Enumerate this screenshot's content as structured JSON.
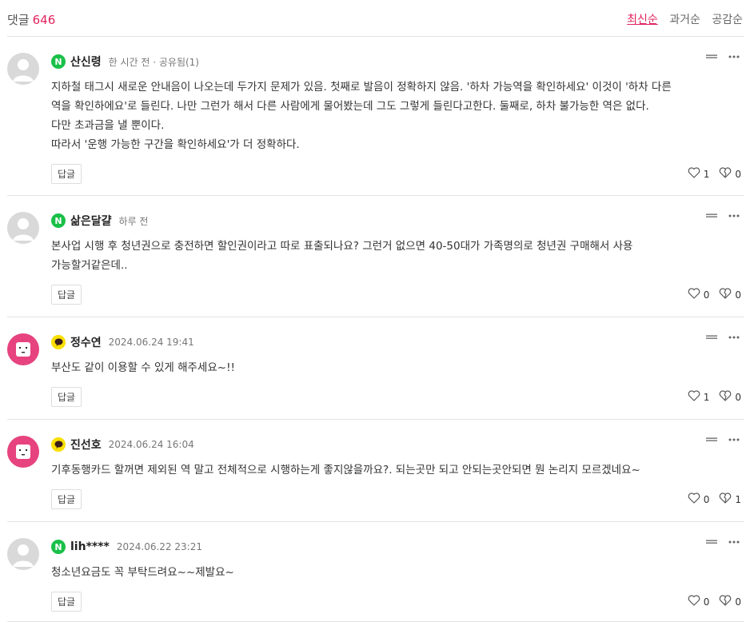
{
  "header": {
    "count_label": "댓글",
    "count_value": "646",
    "sort_options": [
      "최신순",
      "과거순",
      "공감순"
    ],
    "active_sort": "최신순"
  },
  "comments": [
    {
      "name": "산신령",
      "badge": "N",
      "time": "한 시간 전 · 공유됨(1)",
      "text": "지하철 태그시 새로운 안내음이 나오는데 두가지 문제가 있음. 첫째로 발음이 정확하지 않음. '하차 가능역을 확인하세요' 이것이 '하차 다른\n역을 확인하에요'로 들린다. 나만 그런가 해서 다른 사람에게 물어봤는데 그도 그렇게 들린다고한다. 둘째로, 하차 불가능한 역은 없다.\n다만 초과금을 낼 뿐이다.\n따라서 '운행 가능한 구간을 확인하세요'가 더 정확하다.",
      "reply_label": "답글",
      "likes": "1",
      "dislikes": "0",
      "avatar": "default"
    },
    {
      "name": "삶은달걀",
      "badge": "N",
      "time": "하루 전",
      "text": "본사업 시행 후 청년권으로 충전하면 할인권이라고 따로 표출되나요? 그런거 없으면 40-50대가 가족명의로 청년권 구매해서 사용\n가능할거같은데..",
      "reply_label": "답글",
      "likes": "0",
      "dislikes": "0",
      "avatar": "default"
    },
    {
      "name": "정수연",
      "badge": "K",
      "time": "2024.06.24 19:41",
      "text": "부산도 같이 이용할 수 있게 해주세요~!!",
      "reply_label": "답글",
      "likes": "1",
      "dislikes": "0",
      "avatar": "pink"
    },
    {
      "name": "진선호",
      "badge": "K",
      "time": "2024.06.24 16:04",
      "text": "기후동행카드 할꺼면 제외된 역 말고 전체적으로 시행하는게 좋지않을까요?. 되는곳만 되고 안되는곳안되면 뭔 논리지 모르겠네요~",
      "reply_label": "답글",
      "likes": "0",
      "dislikes": "1",
      "avatar": "pink"
    },
    {
      "name": "lih****",
      "badge": "N",
      "time": "2024.06.22 23:21",
      "text": "청소년요금도 꼭 부탁드려요~~제발요~",
      "reply_label": "답글",
      "likes": "0",
      "dislikes": "0",
      "avatar": "default"
    }
  ],
  "icons": {
    "badge_n": "naver-badge-icon",
    "badge_k": "kakao-badge-icon",
    "menu": "menu-icon",
    "more": "more-icon",
    "like": "heart-icon",
    "dislike": "broken-heart-icon"
  },
  "colors": {
    "accent": "#e0245e",
    "naver_green": "#19c048",
    "kakao_yellow": "#f9df00",
    "avatar_pink": "#e6437f"
  }
}
